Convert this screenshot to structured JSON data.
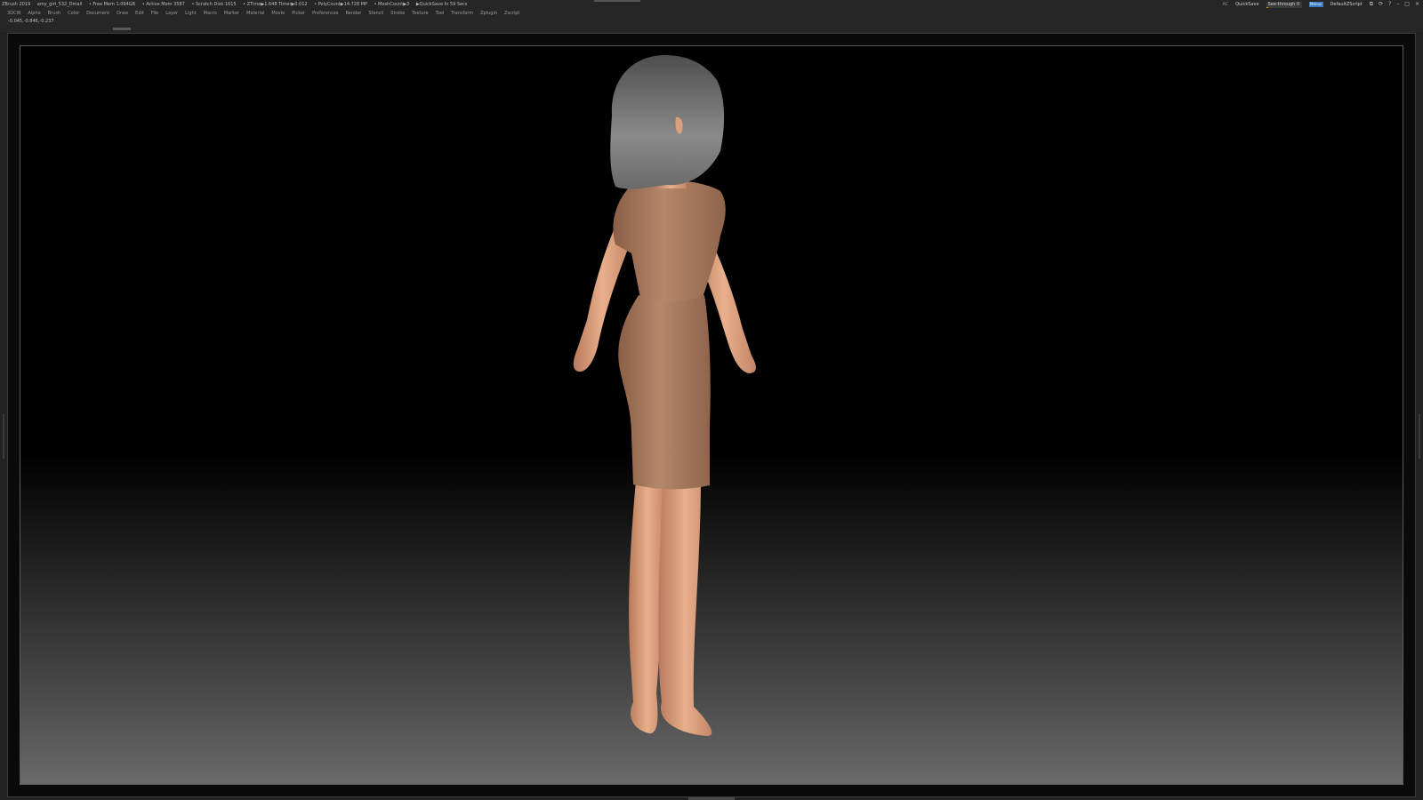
{
  "titlebar": {
    "app": "ZBrush 2019",
    "file": "amy_girl_532_Dmail",
    "free_mem": "• Free Mem 1.094GB",
    "active_mem": "• Active Mem 3587",
    "scratch_disk": "• Scratch Disk 1615",
    "ztime": "• ZTime▶1.648 Timer▶0.012",
    "polycount": "• PolyCount▶14.728 MP",
    "meshcount": "• MeshCount▶3",
    "quicksave_in": "▶QuickSave In 59 Secs",
    "ac": "AC",
    "quicksave": "QuickSave",
    "see_through": "See-through  0",
    "see_through_level": 0.05,
    "menus": "Menus",
    "default_script": "DefaultZScript",
    "accent_color": "#3b7bc4",
    "slider_color": "#d5a400"
  },
  "window_icons": [
    "layout-icon",
    "sync-icon",
    "help-icon",
    "minimize-icon",
    "maximize-icon",
    "close-icon"
  ],
  "menubar": {
    "items": [
      "3DCW",
      "Alpha",
      "Brush",
      "Color",
      "Document",
      "Draw",
      "Edit",
      "File",
      "Layer",
      "Light",
      "Macro",
      "Marker",
      "Material",
      "Movie",
      "Picker",
      "Preferences",
      "Render",
      "Stencil",
      "Stroke",
      "Texture",
      "Tool",
      "Transform",
      "Zplugin",
      "Zscript"
    ]
  },
  "infobar": {
    "coordinates": "-0.045,-0.846,-0.237"
  },
  "viewport": {
    "subject": "3d-character-model",
    "background_top": "#000000",
    "background_bottom": "#6a6a6a",
    "skin_color": "#e0a27f",
    "dress_color": "#a97a5d",
    "hair_color": "#7c7c7c"
  }
}
